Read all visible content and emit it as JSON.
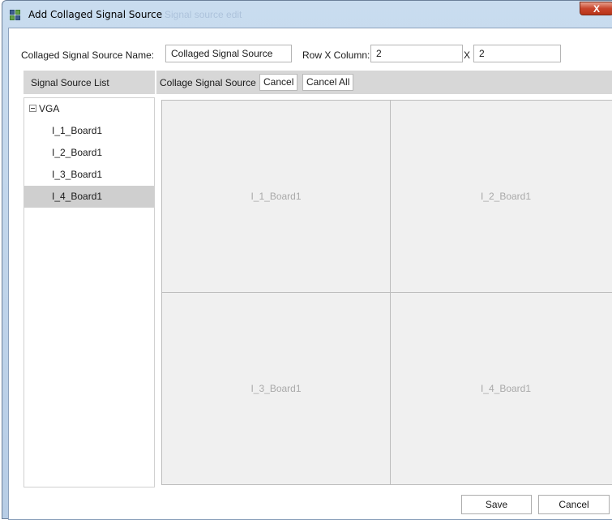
{
  "window": {
    "title": "Add Collaged Signal Source",
    "ghost_title": "Signal source edit",
    "close_glyph": "X"
  },
  "form": {
    "name_label": "Collaged Signal Source Name:",
    "name_value": "Collaged Signal Source",
    "rowcol_label": "Row X Column:",
    "rows_value": "2",
    "x_label": "X",
    "cols_value": "2"
  },
  "source_list": {
    "header": "Signal Source List",
    "group": "VGA",
    "items": [
      "I_1_Board1",
      "I_2_Board1",
      "I_3_Board1",
      "I_4_Board1"
    ],
    "selected_index": 3
  },
  "collage": {
    "header": "Collage Signal Source",
    "cancel_label": "Cancel",
    "cancel_all_label": "Cancel All",
    "cells": [
      "I_1_Board1",
      "I_2_Board1",
      "I_3_Board1",
      "I_4_Board1"
    ]
  },
  "footer": {
    "save_label": "Save",
    "cancel_label": "Cancel"
  }
}
